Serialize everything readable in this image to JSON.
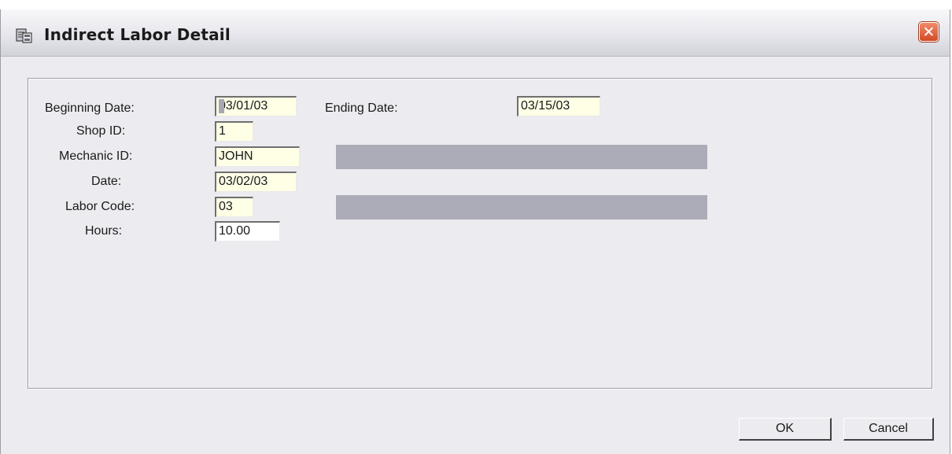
{
  "window": {
    "title": "Indirect Labor Detail",
    "icon": "app-form-icon",
    "close_icon": "close-icon",
    "close_glyph": "✕"
  },
  "form": {
    "beginning_date": {
      "label": "Beginning Date:",
      "value": "03/01/03"
    },
    "ending_date": {
      "label": "Ending Date:",
      "value": "03/15/03"
    },
    "shop_id": {
      "label": "Shop ID:",
      "value": "1"
    },
    "mechanic_id": {
      "label": "Mechanic ID:",
      "value": "JOHN",
      "description": ""
    },
    "date": {
      "label": "Date:",
      "value": "03/02/03"
    },
    "labor_code": {
      "label": "Labor Code:",
      "value": "03",
      "description": ""
    },
    "hours": {
      "label": "Hours:",
      "value": "10.00"
    }
  },
  "buttons": {
    "ok": "OK",
    "cancel": "Cancel"
  },
  "colors": {
    "field_background": "#ffffe6",
    "description_background": "#acacb8",
    "window_background": "#ececf0",
    "close_button": "#d24a24"
  }
}
